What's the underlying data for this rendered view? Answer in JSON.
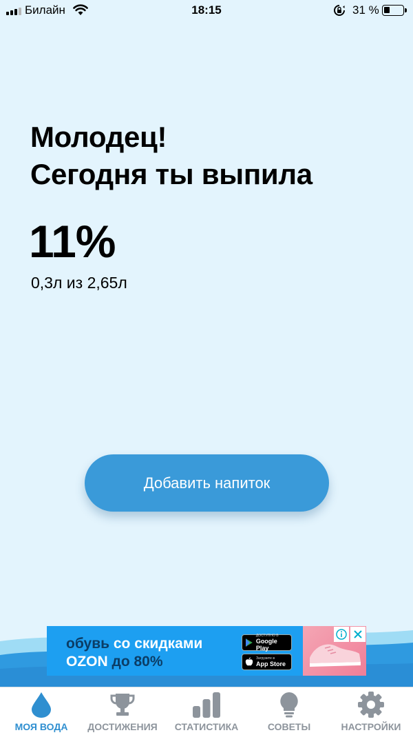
{
  "status_bar": {
    "carrier": "Билайн",
    "time": "18:15",
    "battery": "31 %",
    "battery_level": 0.31
  },
  "main": {
    "headline_line1": "Молодец!",
    "headline_line2": "Сегодня ты выпила",
    "percent": "11%",
    "amount": "0,3л из 2,65л",
    "progress": 0.11,
    "add_button": "Добавить напиток"
  },
  "ad": {
    "line1_a": "обувь",
    "line1_b": "со скидками",
    "line2_a": "OZON",
    "line2_b": "до 80%",
    "google_play_small": "ДОСТУПНО В",
    "google_play": "Google Play",
    "app_store_small": "Загрузите в",
    "app_store": "App Store",
    "info_icon": "info-icon",
    "close_icon": "close-icon"
  },
  "tabs": [
    {
      "label": "МОЯ ВОДА",
      "icon": "water-drop-icon",
      "active": true
    },
    {
      "label": "ДОСТИЖЕНИЯ",
      "icon": "trophy-icon",
      "active": false
    },
    {
      "label": "СТАТИСТИКА",
      "icon": "bar-chart-icon",
      "active": false
    },
    {
      "label": "СОВЕТЫ",
      "icon": "lightbulb-icon",
      "active": false
    },
    {
      "label": "НАСТРОЙКИ",
      "icon": "gear-icon",
      "active": false
    }
  ],
  "colors": {
    "background": "#e3f4fd",
    "accent": "#3a9ad9",
    "tab_active": "#2f8fd0",
    "tab_inactive": "#8d949c"
  }
}
